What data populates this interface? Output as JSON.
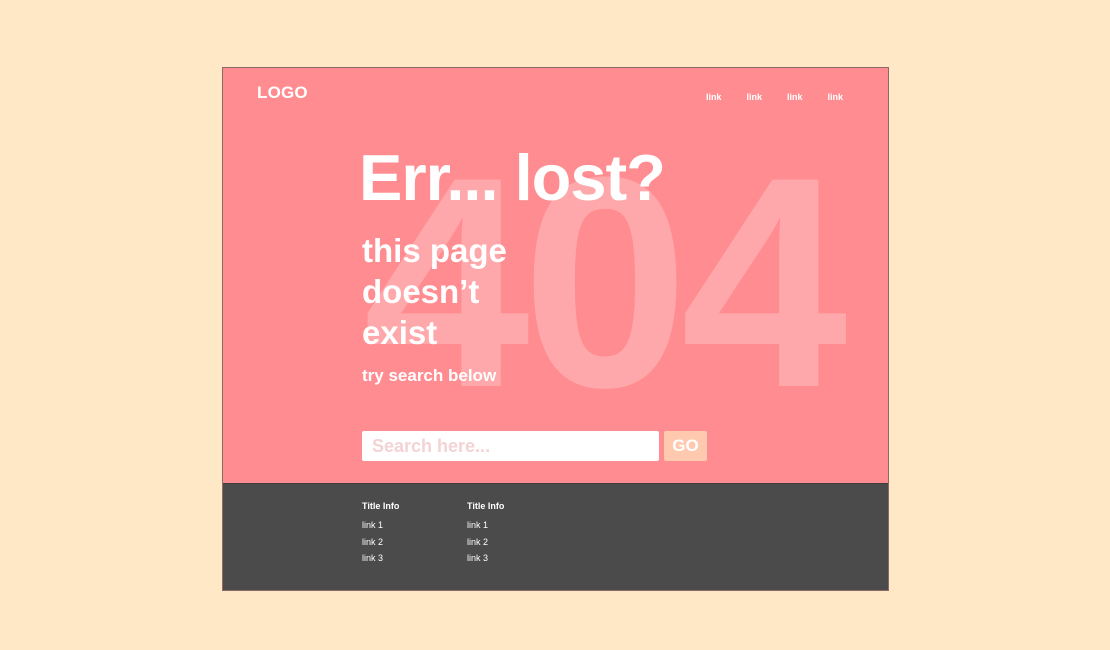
{
  "header": {
    "logo": "LOGO",
    "nav": [
      "link",
      "link",
      "link",
      "link"
    ]
  },
  "hero": {
    "background_number": "404",
    "headline": "Err... lost?",
    "subline": [
      "this page",
      "doesn’t",
      "exist"
    ],
    "hint": "try search below"
  },
  "search": {
    "placeholder": "Search here...",
    "value": "",
    "button_label": "GO"
  },
  "footer": {
    "columns": [
      {
        "title": "Title Info",
        "links": [
          "link 1",
          "link 2",
          "link 3"
        ]
      },
      {
        "title": "Title Info",
        "links": [
          "link 1",
          "link 2",
          "link 3"
        ]
      }
    ]
  },
  "colors": {
    "page_background": "#ffe8c6",
    "hero_background": "#ff8c90",
    "background_number": "#ffa8ab",
    "footer_background": "#4b4b4b",
    "go_button": "#ffc9b0",
    "text": "#ffffff"
  }
}
